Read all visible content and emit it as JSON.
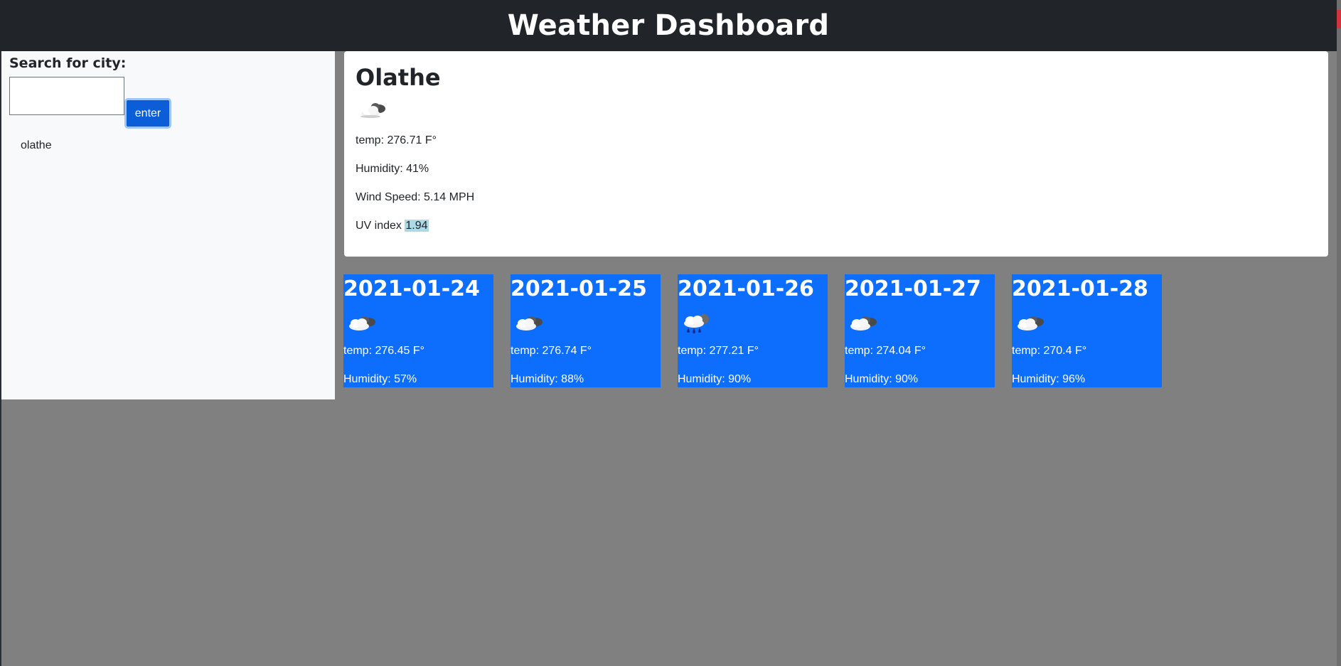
{
  "header": {
    "title": "Weather Dashboard"
  },
  "sidebar": {
    "search_label": "Search for city:",
    "search_value": "",
    "enter_label": "enter",
    "history": [
      "olathe"
    ]
  },
  "current": {
    "city": "Olathe",
    "icon": "cloud-icon",
    "temp": "temp: 276.71 F°",
    "humidity": "Humidity: 41%",
    "wind": "Wind Speed: 5.14 MPH",
    "uv_label": "UV index ",
    "uv_value": "1.94",
    "uv_color": "#add8e6"
  },
  "forecast": [
    {
      "date": "2021-01-24",
      "icon": "cloud-icon",
      "temp": "temp: 276.45 F°",
      "humidity": "Humidity: 57%"
    },
    {
      "date": "2021-01-25",
      "icon": "cloud-icon",
      "temp": "temp: 276.74 F°",
      "humidity": "Humidity: 88%"
    },
    {
      "date": "2021-01-26",
      "icon": "rain-cloud-icon",
      "temp": "temp: 277.21 F°",
      "humidity": "Humidity: 90%"
    },
    {
      "date": "2021-01-27",
      "icon": "cloud-icon",
      "temp": "temp: 274.04 F°",
      "humidity": "Humidity: 90%"
    },
    {
      "date": "2021-01-28",
      "icon": "cloud-icon",
      "temp": "temp: 270.4 F°",
      "humidity": "Humidity: 96%"
    }
  ],
  "colors": {
    "header_bg": "#212529",
    "page_bg": "#808080",
    "sidebar_bg": "#f8f9fa",
    "card_bg": "#0d6efd",
    "button_bg": "#0b5ed7"
  }
}
